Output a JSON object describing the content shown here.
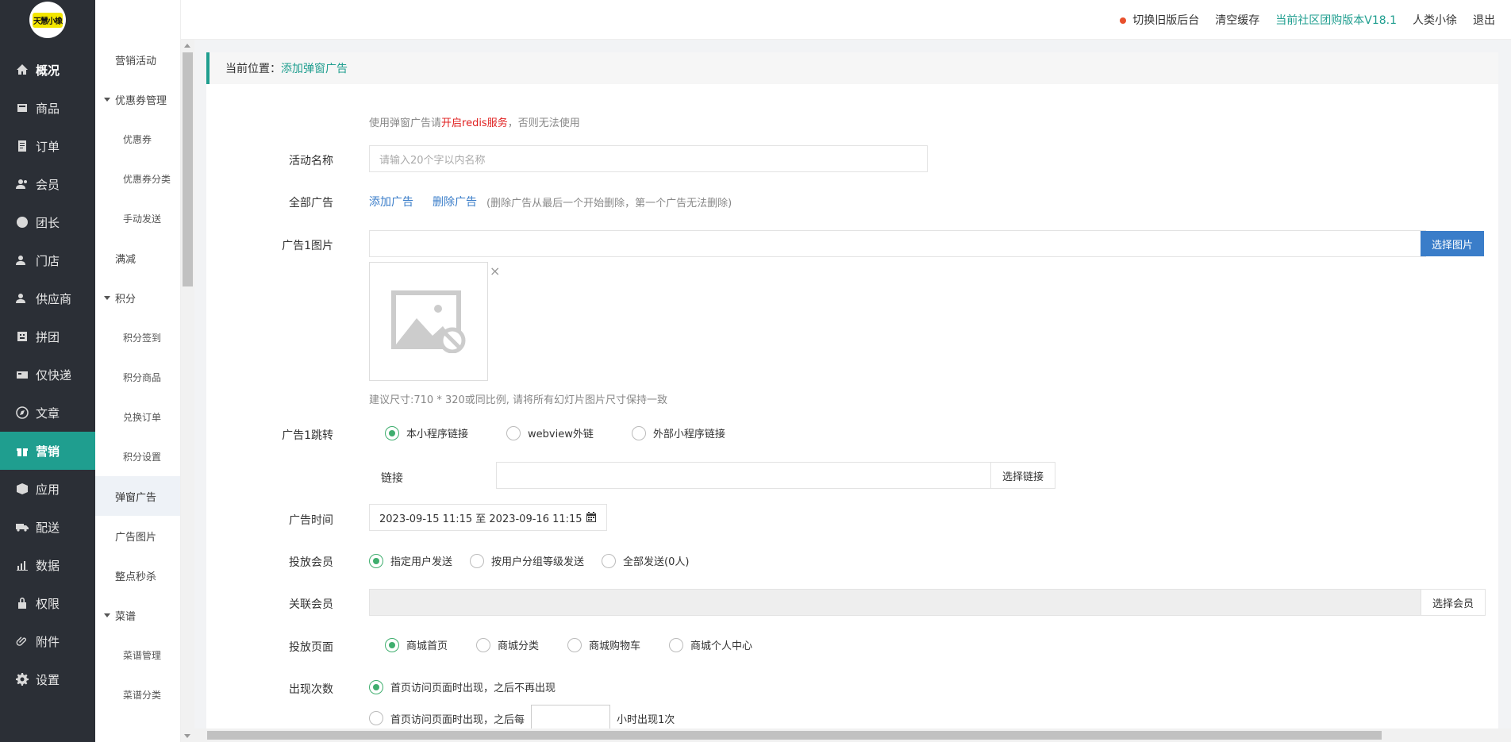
{
  "sidebar": {
    "logo_text": "天慧小橡",
    "items": [
      {
        "label": "概况",
        "icon": "home-icon"
      },
      {
        "label": "商品",
        "icon": "goods-icon"
      },
      {
        "label": "订单",
        "icon": "order-icon"
      },
      {
        "label": "会员",
        "icon": "member-icon"
      },
      {
        "label": "团长",
        "icon": "leader-icon"
      },
      {
        "label": "门店",
        "icon": "store-icon"
      },
      {
        "label": "供应商",
        "icon": "supplier-icon"
      },
      {
        "label": "拼团",
        "icon": "group-buy-icon"
      },
      {
        "label": "仅快递",
        "icon": "express-icon"
      },
      {
        "label": "文章",
        "icon": "article-icon"
      },
      {
        "label": "营销",
        "icon": "gift-icon"
      },
      {
        "label": "应用",
        "icon": "app-icon"
      },
      {
        "label": "配送",
        "icon": "truck-icon"
      },
      {
        "label": "数据",
        "icon": "chart-icon"
      },
      {
        "label": "权限",
        "icon": "lock-icon"
      },
      {
        "label": "附件",
        "icon": "attachment-icon"
      },
      {
        "label": "设置",
        "icon": "gear-icon"
      }
    ]
  },
  "submenu": {
    "items": [
      {
        "label": "营销活动"
      },
      {
        "label": "优惠券管理"
      },
      {
        "label": "优惠券"
      },
      {
        "label": "优惠券分类"
      },
      {
        "label": "手动发送"
      },
      {
        "label": "满减"
      },
      {
        "label": "积分"
      },
      {
        "label": "积分签到"
      },
      {
        "label": "积分商品"
      },
      {
        "label": "兑换订单"
      },
      {
        "label": "积分设置"
      },
      {
        "label": "弹窗广告"
      },
      {
        "label": "广告图片"
      },
      {
        "label": "整点秒杀"
      },
      {
        "label": "菜谱"
      },
      {
        "label": "菜谱管理"
      },
      {
        "label": "菜谱分类"
      }
    ]
  },
  "topbar": {
    "switch_old": "切换旧版后台",
    "clear_cache": "清空缓存",
    "version": "当前社区团购版本V18.1",
    "user": "人类小徐",
    "logout": "退出"
  },
  "breadcrumb": {
    "prefix": "当前位置：",
    "current": "添加弹窗广告"
  },
  "form": {
    "notice_pre": "使用弹窗广告请",
    "notice_red": "开启redis服务",
    "notice_post": "，否则无法使用",
    "name_label": "活动名称",
    "name_placeholder": "请输入20个字以内名称",
    "all_ads_label": "全部广告",
    "add_ad": "添加广告",
    "del_ad": "删除广告",
    "del_hint": "(删除广告从最后一个开始删除，第一个广告无法删除)",
    "ad1_img_label": "广告1图片",
    "select_image": "选择图片",
    "size_hint": "建议尺寸:710 * 320或同比例, 请将所有幻灯片图片尺寸保持一致",
    "ad1_jump_label": "广告1跳转",
    "jump_options": [
      "本小程序链接",
      "webview外链",
      "外部小程序链接"
    ],
    "link_label": "链接",
    "select_link": "选择链接",
    "time_label": "广告时间",
    "time_value": "2023-09-15 11:15 至 2023-09-16 11:15",
    "target_label": "投放会员",
    "target_options": [
      "指定用户发送",
      "按用户分组等级发送",
      "全部发送(0人)"
    ],
    "assoc_label": "关联会员",
    "select_member": "选择会员",
    "page_label": "投放页面",
    "page_options": [
      "商城首页",
      "商城分类",
      "商城购物车",
      "商城个人中心"
    ],
    "freq_label": "出现次数",
    "freq_opt1": "首页访问页面时出现，之后不再出现",
    "freq_opt2_pre": "首页访问页面时出现，之后每",
    "freq_opt2_post": "小时出现1次"
  }
}
